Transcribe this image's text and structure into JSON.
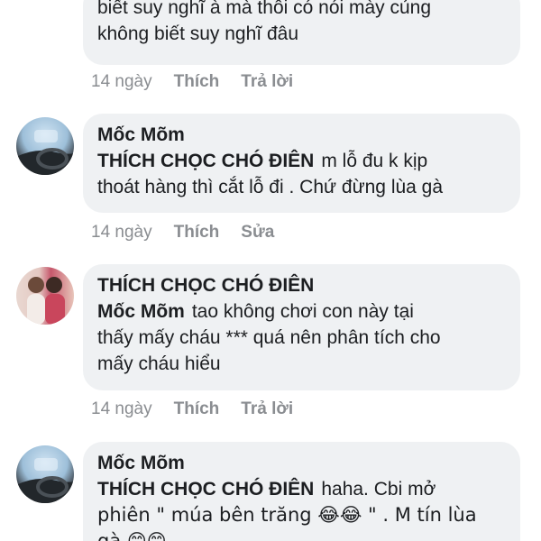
{
  "comments": [
    {
      "text_lines": [
        "biết suy nghĩ à mà thôi có nói mày củng",
        "không biết suy nghĩ đâu"
      ],
      "time": "14 ngày",
      "like": "Thích",
      "reply": "Trả lời"
    },
    {
      "name": "Mốc Mõm",
      "mention": "THÍCH CHỌC CHÓ ĐIÊN",
      "text_first": "m lỗ đu k kịp",
      "text_lines": [
        "thoát hàng thì cắt lỗ đi . Chứ đừng lùa gà"
      ],
      "time": "14 ngày",
      "like": "Thích",
      "action2": "Sửa",
      "avatar_icon": "car-steering-wheel-avatar"
    },
    {
      "name": "THÍCH CHỌC CHÓ ĐIÊN",
      "mention": "Mốc Mõm",
      "text_first": "tao không chơi con này tại",
      "text_lines": [
        "thấy mấy cháu *** quá nên phân tích cho",
        "mấy cháu hiểu"
      ],
      "time": "14 ngày",
      "like": "Thích",
      "reply": "Trả lời",
      "avatar_icon": "two-girls-avatar"
    },
    {
      "name": "Mốc Mõm",
      "mention": "THÍCH CHỌC CHÓ ĐIÊN",
      "text_first": "haha. Cbi mở",
      "text_lines": [
        "phiên \" múa bên trăng 😂😂 \" . M tín lùa",
        "gà 😊😊"
      ],
      "avatar_icon": "car-steering-wheel-avatar"
    }
  ]
}
